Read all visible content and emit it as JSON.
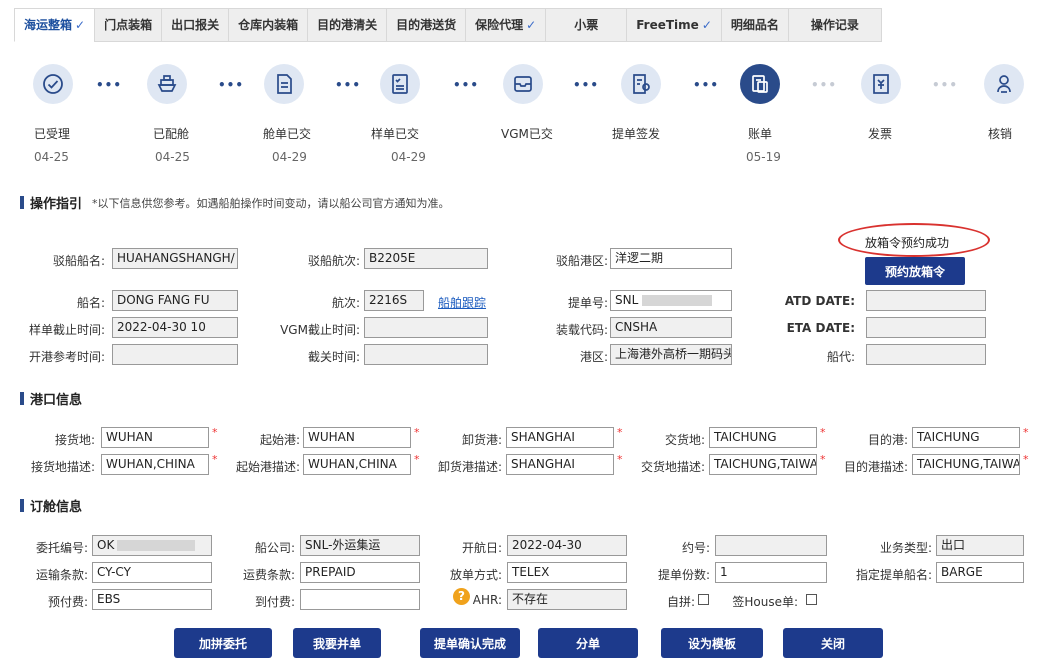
{
  "tabs": [
    {
      "label": "海运整箱",
      "check": "✓"
    },
    {
      "label": "门点装箱",
      "check": ""
    },
    {
      "label": "出口报关",
      "check": ""
    },
    {
      "label": "仓库内装箱",
      "check": ""
    },
    {
      "label": "目的港清关",
      "check": ""
    },
    {
      "label": "目的港送货",
      "check": ""
    },
    {
      "label": "保险代理",
      "check": "✓"
    },
    {
      "label": "小票",
      "check": ""
    },
    {
      "label": "FreeTime",
      "check": "✓"
    },
    {
      "label": "明细品名",
      "check": ""
    },
    {
      "label": "操作记录",
      "check": ""
    }
  ],
  "steps": [
    {
      "label": "已受理",
      "date": "04-25",
      "icon": "check-circle-icon"
    },
    {
      "label": "已配舱",
      "date": "04-25",
      "icon": "ship-icon"
    },
    {
      "label": "舱单已交",
      "date": "04-29",
      "icon": "document-icon"
    },
    {
      "label": "样单已交",
      "date": "04-29",
      "icon": "checklist-icon"
    },
    {
      "label": "VGM已交",
      "date": "",
      "icon": "tray-icon"
    },
    {
      "label": "提单签发",
      "date": "",
      "icon": "bill-stamp-icon"
    },
    {
      "label": "账单",
      "date": "05-19",
      "icon": "ledger-icon"
    },
    {
      "label": "发票",
      "date": "",
      "icon": "invoice-icon"
    },
    {
      "label": "核销",
      "date": "",
      "icon": "writeoff-icon"
    }
  ],
  "guide": {
    "title": "操作指引",
    "note": "*以下信息供您参考。如遇船舶操作时间变动，请以船公司官方通知为准。",
    "status": "放箱令预约成功",
    "reserve_btn": "预约放箱令",
    "barge_vessel_label": "驳船船名:",
    "barge_vessel": "HUAHANGSHANGH/",
    "barge_voyage_label": "驳船航次:",
    "barge_voyage": "B2205E",
    "barge_area_label": "驳船港区:",
    "barge_area": "洋逻二期",
    "vessel_label": "船名:",
    "vessel": "DONG FANG FU",
    "voyage_label": "航次:",
    "voyage": "2216S",
    "track_link": "船舶跟踪",
    "bl_label": "提单号:",
    "bl": "SNL",
    "atd_label": "ATD DATE:",
    "atd": "",
    "sample_cut_label": "样单截止时间:",
    "sample_cut": "2022-04-30 10",
    "vgm_cut_label": "VGM截止时间:",
    "vgm_cut": "",
    "load_code_label": "装载代码:",
    "load_code": "CNSHA",
    "eta_label": "ETA DATE:",
    "eta": "",
    "open_ref_label": "开港参考时间:",
    "open_ref": "",
    "customs_cut_label": "截关时间:",
    "customs_cut": "",
    "port_area_label": "港区:",
    "port_area": "上海港外高桥一期码头",
    "agent_label": "船代:",
    "agent": ""
  },
  "port": {
    "title": "港口信息",
    "receipt_label": "接货地:",
    "receipt": "WUHAN",
    "pol_label": "起始港:",
    "pol": "WUHAN",
    "pod_label": "卸货港:",
    "pod": "SHANGHAI",
    "delivery_label": "交货地:",
    "delivery": "TAICHUNG",
    "dest_label": "目的港:",
    "dest": "TAICHUNG",
    "receipt_desc_label": "接货地描述:",
    "receipt_desc": "WUHAN,CHINA",
    "pol_desc_label": "起始港描述:",
    "pol_desc": "WUHAN,CHINA",
    "pod_desc_label": "卸货港描述:",
    "pod_desc": "SHANGHAI",
    "delivery_desc_label": "交货地描述:",
    "delivery_desc": "TAICHUNG,TAIWA",
    "dest_desc_label": "目的港描述:",
    "dest_desc": "TAICHUNG,TAIWA"
  },
  "booking": {
    "title": "订舱信息",
    "order_label": "委托编号:",
    "order": "OK",
    "carrier_label": "船公司:",
    "carrier": "SNL-外运集运",
    "sail_label": "开航日:",
    "sail": "2022-04-30",
    "contract_label": "约号:",
    "contract": "",
    "biz_label": "业务类型:",
    "biz": "出口",
    "terms_label": "运输条款:",
    "terms": "CY-CY",
    "freight_label": "运费条款:",
    "freight": "PREPAID",
    "release_label": "放单方式:",
    "release": "TELEX",
    "copies_label": "提单份数:",
    "copies": "1",
    "bl_vessel_label": "指定提单船名:",
    "bl_vessel": "BARGE",
    "prepaid_label": "预付费:",
    "prepaid": "EBS",
    "collect_label": "到付费:",
    "collect": "",
    "ahr_label": "AHR:",
    "ahr": "不存在",
    "self_label": "自拼:",
    "house_label": "签House单:"
  },
  "buttons": {
    "combine": "加拼委托",
    "merge": "我要并单",
    "confirm": "提单确认完成",
    "split": "分单",
    "template": "设为模板",
    "close": "关闭"
  },
  "colors": {
    "accent": "#2a4b8a",
    "button": "#1d3a8c",
    "status_ring": "#d9322f"
  }
}
